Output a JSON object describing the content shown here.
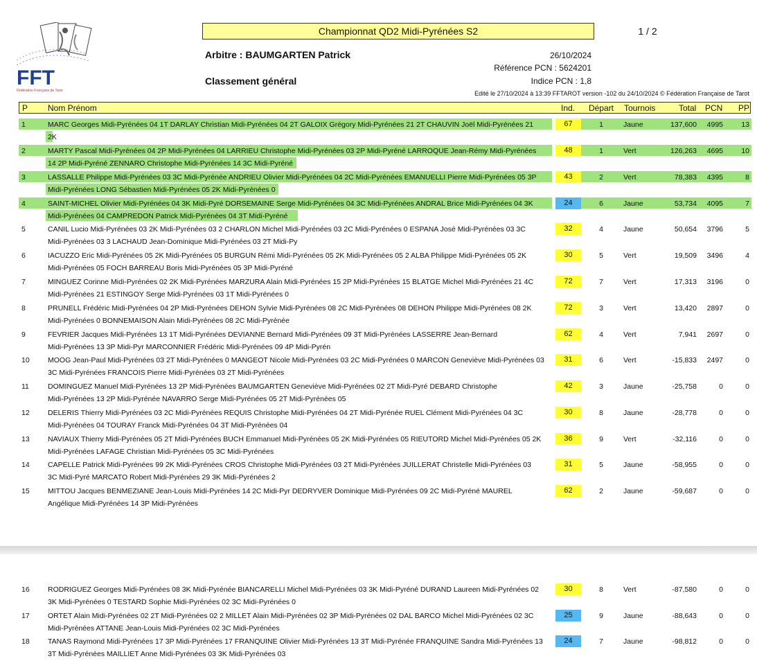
{
  "header": {
    "title": "Championnat QD2 Midi-Pyrénées S2",
    "page": "1 / 2",
    "arbitre": "Arbitre : BAUMGARTEN Patrick",
    "date": "26/10/2024",
    "reference": "Référence PCN : 5624201",
    "indice": "Indice PCN : 1,8",
    "classement": "Classement général",
    "edite": "Edité le 27/10/2024 à 13:39 FFTAROT version -102 du 24/10/2024 © Fédération Française de Tarot",
    "logo_text": "FFT",
    "logo_subtitle": "Fédération Française de Tarot"
  },
  "columns": {
    "p": "P",
    "nom": "Nom Prénom",
    "ind": "Ind.",
    "depart": "Départ",
    "tournois": "Tournois",
    "total": "Total",
    "pcn": "PCN",
    "pp": "PP"
  },
  "colors": {
    "header_bg": "#ffff99",
    "highlight": "#9ee37d",
    "ind_yellow": "#ffff33",
    "ind_blue": "#55b8f0"
  },
  "rows": [
    {
      "p": "1",
      "line1": "MARC Georges Midi-Pyrénées 04 1T DARLAY Christian Midi-Pyrénées 04 2T GALOIX Grégory Midi-Pyrénées 21 2T CHAUVIN Joël Midi-Pyrénées 21",
      "line2": "2K",
      "ind": "67",
      "ind_color": "yellow",
      "depart": "1",
      "tournois": "Jaune",
      "total": "137,600",
      "pcn": "4995",
      "pp": "13",
      "highlight": true
    },
    {
      "p": "2",
      "line1": "MARTY Pascal Midi-Pyrénées 04 2P Midi-Pyrénées 04  LARRIEU Christophe Midi-Pyrénées 03 2P Midi-Pyréné LARROQUE Jean-Rémy Midi-Pyrénées",
      "line2": "14 2P Midi-Pyréné ZENNARO Christophe Midi-Pyrénées 14 3C Midi-Pyréné",
      "ind": "48",
      "ind_color": "yellow",
      "depart": "1",
      "tournois": "Vert",
      "total": "126,263",
      "pcn": "4695",
      "pp": "10",
      "highlight": true
    },
    {
      "p": "3",
      "line1": "LASSALLE Philippe Midi-Pyrénées 03 3C Midi-Pyrénée ANDRIEU Olivier Midi-Pyrénées 04 2C Midi-Pyrénées  EMANUELLI Pierre Midi-Pyrénées 05 3P",
      "line2": "Midi-Pyrénées LONG Sébastien Midi-Pyrénées 05 2K Midi-Pyrénées 0",
      "ind": "43",
      "ind_color": "yellow",
      "depart": "2",
      "tournois": "Vert",
      "total": "78,383",
      "pcn": "4395",
      "pp": "8",
      "highlight": true
    },
    {
      "p": "4",
      "line1": "SAINT-MICHEL Olivier Midi-Pyrénées 04 3K Midi-Pyré DORSEMAINE Serge Midi-Pyrénées 04 3C Midi-Pyrénées ANDRAL Brice Midi-Pyrénées 04 3K",
      "line2": "Midi-Pyrénées 04  CAMPREDON Patrick Midi-Pyrénées 04 3T Midi-Pyréné",
      "ind": "24",
      "ind_color": "blue",
      "depart": "6",
      "tournois": "Jaune",
      "total": "53,734",
      "pcn": "4095",
      "pp": "7",
      "highlight": true
    },
    {
      "p": "5",
      "line1": "CANIL Lucio Midi-Pyrénées 03 2K Midi-Pyrénées 03 2 CHARLON Michel Midi-Pyrénées 03 2C Midi-Pyrénées 0 ESPANA José Midi-Pyrénées 03 3C",
      "line2": "Midi-Pyrénées 03 3 LACHAUD Jean-Dominique Midi-Pyrénées 03 2T Midi-Py",
      "ind": "32",
      "ind_color": "yellow",
      "depart": "4",
      "tournois": "Jaune",
      "total": "50,654",
      "pcn": "3796",
      "pp": "5",
      "highlight": false
    },
    {
      "p": "6",
      "line1": "IACUZZO Eric Midi-Pyrénées 05 2K Midi-Pyrénées 05  BURGUN Rémi Midi-Pyrénées 05 2K Midi-Pyrénées 05 2 ALBA Philippe Midi-Pyrénées 05 2K",
      "line2": "Midi-Pyrénées 05 FOCH BARREAU Boris Midi-Pyrénées 05 3P Midi-Pyréné",
      "ind": "30",
      "ind_color": "yellow",
      "depart": "5",
      "tournois": "Vert",
      "total": "19,509",
      "pcn": "3496",
      "pp": "4",
      "highlight": false
    },
    {
      "p": "7",
      "line1": "MINGUEZ Corinne Midi-Pyrénées 02 2K Midi-Pyrénées  MARZURA Alain Midi-Pyrénées 15 2P Midi-Pyrénées 15 BLATGE Michel Midi-Pyrénées 21 4C",
      "line2": "Midi-Pyrénées 21 ESTINGOY Serge Midi-Pyrénées 03 1T Midi-Pyrénées 0",
      "ind": "72",
      "ind_color": "yellow",
      "depart": "7",
      "tournois": "Vert",
      "total": "17,313",
      "pcn": "3196",
      "pp": "0",
      "highlight": false
    },
    {
      "p": "8",
      "line1": "PRUNELL Frédéric Midi-Pyrénées 04 2P Midi-Pyrénées DEHON Sylvie Midi-Pyrénées 08 2C Midi-Pyrénées 08  DEHON Philippe Midi-Pyrénées 08 2K",
      "line2": "Midi-Pyrénées 0 BONNEMAISON Alain Midi-Pyrénées 08 2C Midi-Pyrénée",
      "ind": "72",
      "ind_color": "yellow",
      "depart": "3",
      "tournois": "Vert",
      "total": "13,420",
      "pcn": "2897",
      "pp": "0",
      "highlight": false
    },
    {
      "p": "9",
      "line1": "FEVRIER Jacques Midi-Pyrénées 13 1T Midi-Pyrénées  DEVIANNE Bernard Midi-Pyrénées 09 3T Midi-Pyrénées LASSERRE Jean-Bernard",
      "line2": "Midi-Pyrénées 13 3P Midi-Pyr MARCONNIER Frédéric Midi-Pyrénées 09 4P Midi-Pyrén",
      "ind": "62",
      "ind_color": "yellow",
      "depart": "4",
      "tournois": "Vert",
      "total": "7,941",
      "pcn": "2697",
      "pp": "0",
      "highlight": false
    },
    {
      "p": "10",
      "line1": "MOOG Jean-Paul Midi-Pyrénées 03 2T Midi-Pyrénées 0 MANGEOT Nicole Midi-Pyrénées 03 2C Midi-Pyrénées 0 MARCON Geneviève Midi-Pyrénées 03",
      "line2": "3C Midi-Pyrénées FRANCOIS Pierre Midi-Pyrénées 03 2T Midi-Pyrénées",
      "ind": "31",
      "ind_color": "yellow",
      "depart": "6",
      "tournois": "Vert",
      "total": "-15,833",
      "pcn": "2497",
      "pp": "0",
      "highlight": false
    },
    {
      "p": "11",
      "line1": "DOMINGUEZ Manuel Midi-Pyrénées 13 2P Midi-Pyrénées BAUMGARTEN Geneviève Midi-Pyrénées 02 2T Midi-Pyré DEBARD Christophe",
      "line2": "Midi-Pyrénées 13 2P Midi-Pyrénée NAVARRO Serge Midi-Pyrénées 05 2T Midi-Pyrénées 05",
      "ind": "42",
      "ind_color": "yellow",
      "depart": "3",
      "tournois": "Jaune",
      "total": "-25,758",
      "pcn": "0",
      "pp": "0",
      "highlight": false
    },
    {
      "p": "12",
      "line1": "DELERIS Thierry Midi-Pyrénées 03 2C Midi-Pyrénées  REQUIS Christophe Midi-Pyrénées 04 2T Midi-Pyrénée RUEL Clément Midi-Pyrénées 04 3C",
      "line2": "Midi-Pyrénées 04  TOURAY Franck Midi-Pyrénées 04 3T Midi-Pyrénées 04",
      "ind": "30",
      "ind_color": "yellow",
      "depart": "8",
      "tournois": "Jaune",
      "total": "-28,778",
      "pcn": "0",
      "pp": "0",
      "highlight": false
    },
    {
      "p": "13",
      "line1": "NAVIAUX Thierry Midi-Pyrénées 05 2T Midi-Pyrénées  BUCH Emmanuel Midi-Pyrénées 05 2K Midi-Pyrénées 05 RIEUTORD Michel Midi-Pyrénées 05 2K",
      "line2": "Midi-Pyrénées  LAFAGE Christian Midi-Pyrénées 05 3C Midi-Pyrénées",
      "ind": "36",
      "ind_color": "yellow",
      "depart": "9",
      "tournois": "Vert",
      "total": "-32,116",
      "pcn": "0",
      "pp": "0",
      "highlight": false
    },
    {
      "p": "14",
      "line1": "CAPELLE Patrick Midi-Pyrénées 99 2K Midi-Pyrénées  CROS Christophe Midi-Pyrénées 03 2T Midi-Pyrénées  JUILLERAT Christelle Midi-Pyrénées 03",
      "line2": "3C Midi-Pyré MARCATO Robert Midi-Pyrénées 29 3K Midi-Pyrénées 2",
      "ind": "31",
      "ind_color": "yellow",
      "depart": "5",
      "tournois": "Jaune",
      "total": "-58,955",
      "pcn": "0",
      "pp": "0",
      "highlight": false
    },
    {
      "p": "15",
      "line1": "MITTOU Jacques   BENMEZIANE Jean-Louis Midi-Pyrénées 14 2C Midi-Pyr DEDRYVER Dominique Midi-Pyrénées 09 2C Midi-Pyréné MAUREL",
      "line2": "Angélique Midi-Pyrénées 14 3P Midi-Pyrénées",
      "ind": "62",
      "ind_color": "yellow",
      "depart": "2",
      "tournois": "Jaune",
      "total": "-59,687",
      "pcn": "0",
      "pp": "0",
      "highlight": false
    },
    {
      "p": "16",
      "line1": "RODRIGUEZ Georges Midi-Pyrénées 08 3K Midi-Pyrénée BIANCARELLI Michel Midi-Pyrénées 03 3K Midi-Pyréné DURAND Laureen Midi-Pyrénées 02",
      "line2": "3K Midi-Pyrénées 0 TESTARD Sophie Midi-Pyrénées 02 3C Midi-Pyrénées 0",
      "ind": "30",
      "ind_color": "yellow",
      "depart": "8",
      "tournois": "Vert",
      "total": "-87,580",
      "pcn": "0",
      "pp": "0",
      "highlight": false
    },
    {
      "p": "17",
      "line1": "ORTET Alain Midi-Pyrénées 02 2T Midi-Pyrénées 02 2 MILLET Alain Midi-Pyrénées 02 3P Midi-Pyrénées 02  DAL BARCO Michel Midi-Pyrénées 02 3C",
      "line2": "Midi-Pyrénées ATTANE Jean-Louis Midi-Pyrénées 02 3C Midi-Pyrénées",
      "ind": "25",
      "ind_color": "blue",
      "depart": "9",
      "tournois": "Jaune",
      "total": "-88,643",
      "pcn": "0",
      "pp": "0",
      "highlight": false
    },
    {
      "p": "18",
      "line1": "TANAS Raymond Midi-Pyrénées 17 3P Midi-Pyrénées 17 FRANQUINE Olivier Midi-Pyrénées 13 3T Midi-Pyrénée FRANQUINE Sandra Midi-Pyrénées 13",
      "line2": "3T Midi-Pyrénées MAILLIET Anne Midi-Pyrénées 03 3K Midi-Pyrénées 03",
      "ind": "24",
      "ind_color": "blue",
      "depart": "7",
      "tournois": "Jaune",
      "total": "-98,812",
      "pcn": "0",
      "pp": "0",
      "highlight": false
    }
  ]
}
